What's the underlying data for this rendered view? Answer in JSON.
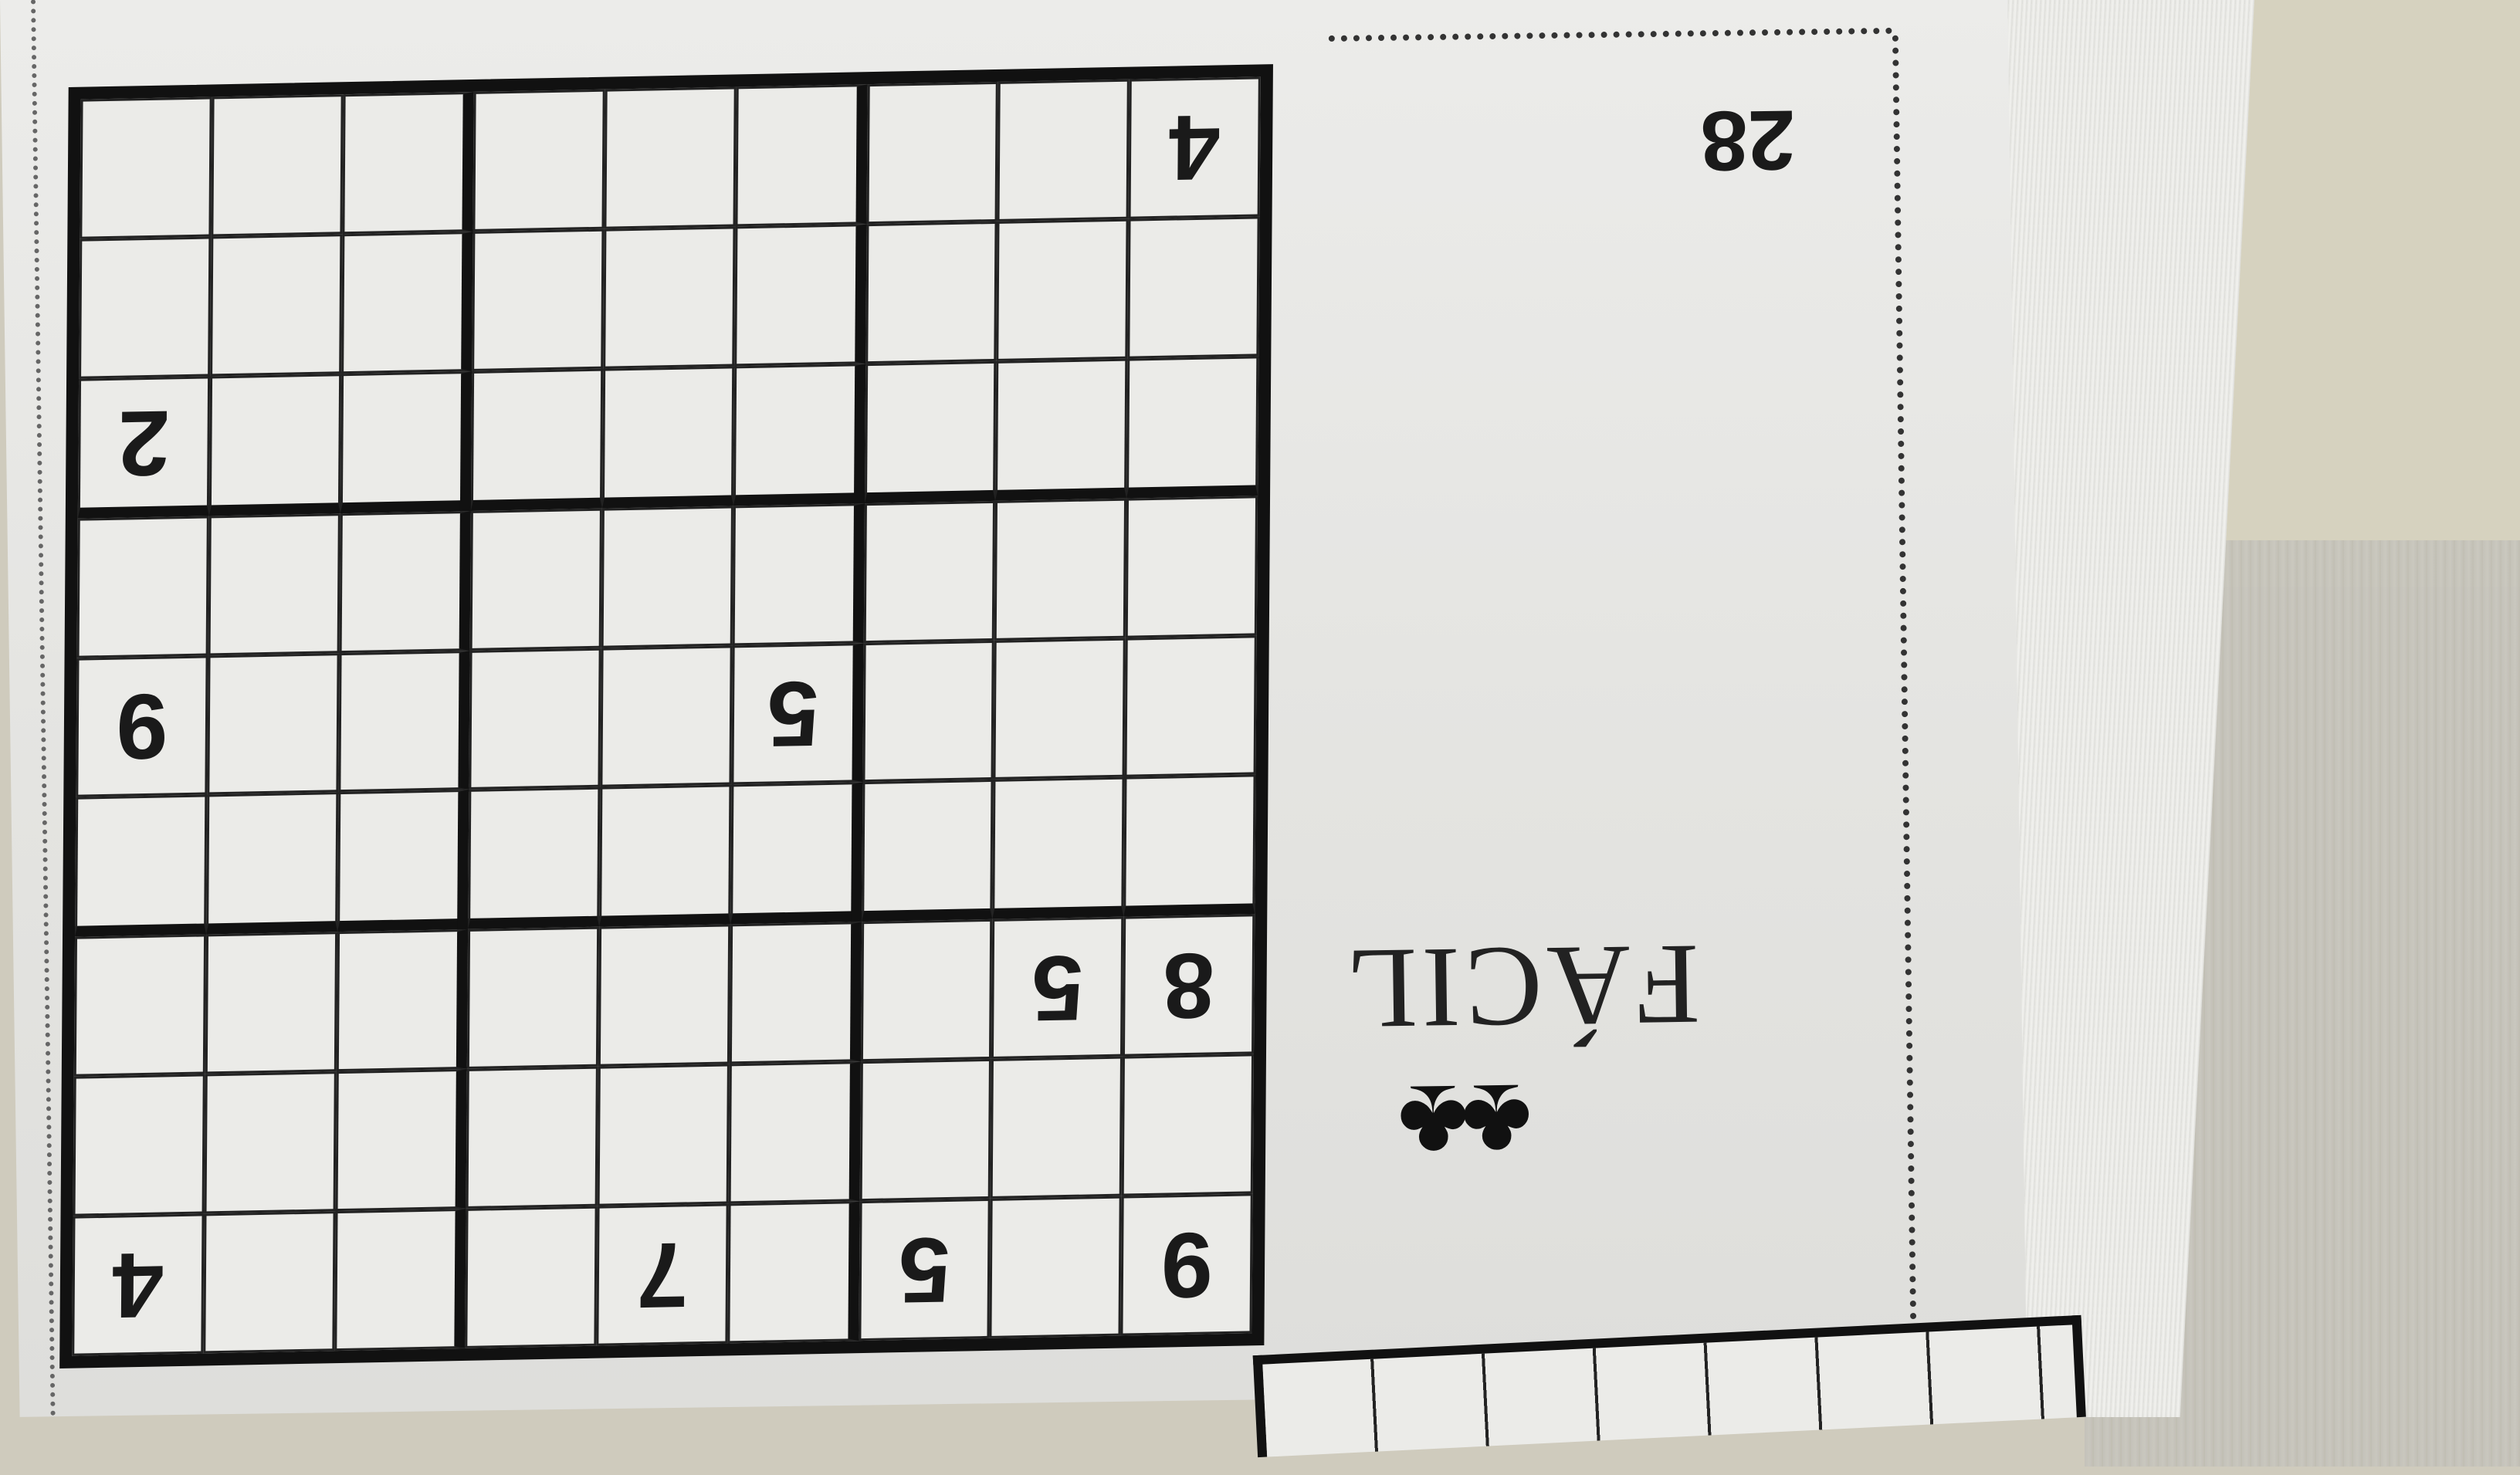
{
  "page": {
    "number": "28",
    "difficulty": "FÁCIL",
    "difficulty_symbol": "♣♣"
  },
  "sudoku": {
    "rows": [
      [
        "9",
        "",
        "5",
        "",
        "7",
        "",
        "",
        "",
        "4"
      ],
      [
        "",
        "",
        "",
        "",
        "",
        "",
        "",
        "",
        ""
      ],
      [
        "8",
        "5",
        "",
        "",
        "",
        "",
        "",
        "",
        ""
      ],
      [
        "",
        "",
        "",
        "",
        "",
        "",
        "",
        "",
        ""
      ],
      [
        "",
        "",
        "",
        "5",
        "",
        "",
        "",
        "",
        "9"
      ],
      [
        "",
        "",
        "",
        "",
        "",
        "",
        "",
        "",
        ""
      ],
      [
        "",
        "",
        "",
        "",
        "",
        "",
        "",
        "",
        "2"
      ],
      [
        "",
        "",
        "",
        "",
        "",
        "",
        "",
        "",
        ""
      ],
      [
        "4",
        "",
        "",
        "",
        "",
        "",
        "",
        "",
        ""
      ]
    ]
  }
}
